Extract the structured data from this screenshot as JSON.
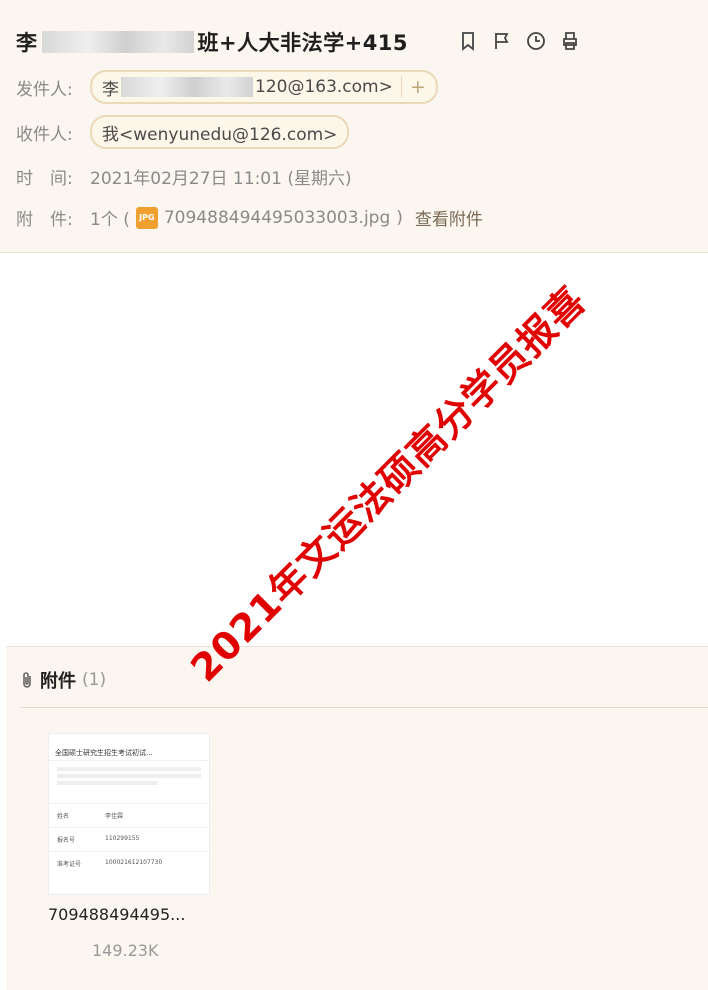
{
  "subject": {
    "prefix": "李",
    "suffix": "班+人大非法学+415"
  },
  "actions": [
    "bookmark-icon",
    "flag-icon",
    "clock-icon",
    "print-icon"
  ],
  "meta": {
    "from_label": "发件人:",
    "from_name": "李",
    "from_email_tail": "120@163.com>",
    "from_add": "+",
    "to_label": "收件人:",
    "to_value": "我<wenyunedu@126.com>",
    "time_label": "时　间:",
    "time_value": "2021年02月27日 11:01 (星期六)",
    "attach_label": "附　件:",
    "attach_count": "1个 (",
    "attach_icon_text": "JPG",
    "attach_file": "709488494495033003.jpg",
    "attach_close": ")",
    "attach_view": "查看附件"
  },
  "stamp_text": "2021年文运法硕高分学员报喜",
  "attachments": {
    "title": "附件",
    "count": "(1)",
    "items": [
      {
        "name": "709488494495...",
        "size": "149.23K",
        "preview": {
          "title": "全国硕士研究生招生考试初试...",
          "rows": [
            {
              "k": "姓名",
              "v": "李佳霖"
            },
            {
              "k": "报名号",
              "v": "110299155"
            },
            {
              "k": "准考证号",
              "v": "100021612107730"
            }
          ]
        }
      }
    ]
  }
}
